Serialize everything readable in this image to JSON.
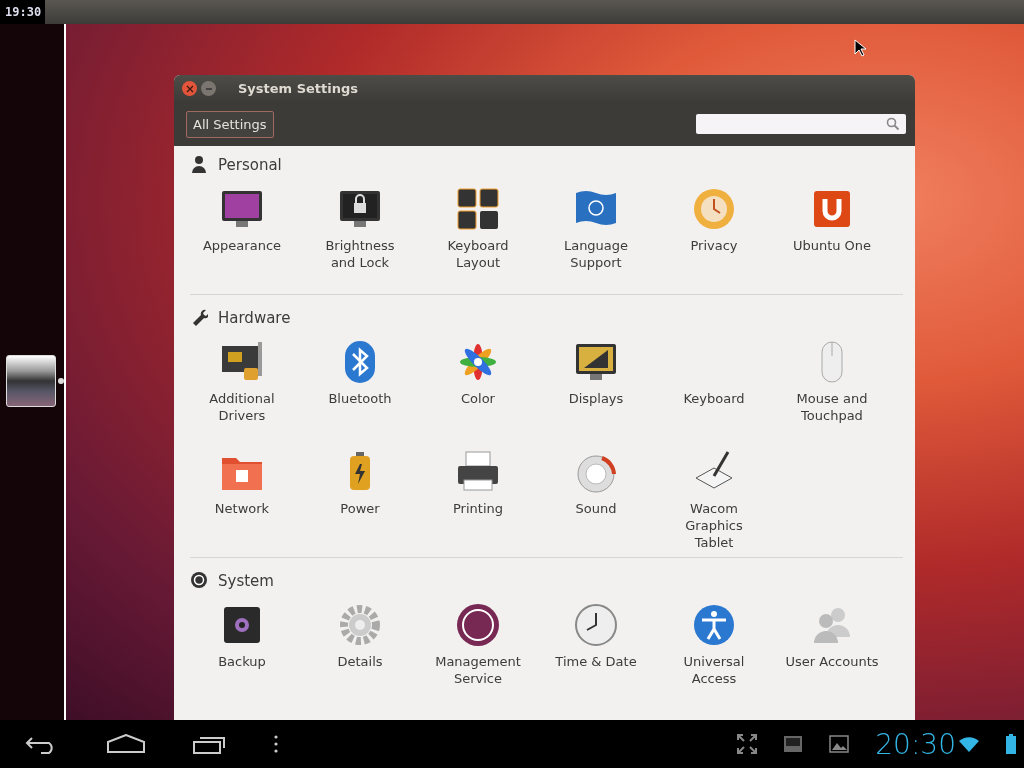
{
  "top_bar": {
    "clock": "19:30"
  },
  "window": {
    "title": "System Settings",
    "all_settings_button": "All Settings"
  },
  "sections": [
    {
      "kind": "personal",
      "title": "Personal",
      "items": [
        {
          "label": "Appearance"
        },
        {
          "label": "Brightness\nand Lock"
        },
        {
          "label": "Keyboard\nLayout"
        },
        {
          "label": "Language\nSupport"
        },
        {
          "label": "Privacy"
        },
        {
          "label": "Ubuntu One"
        }
      ]
    },
    {
      "kind": "hardware",
      "title": "Hardware",
      "items": [
        {
          "label": "Additional\nDrivers"
        },
        {
          "label": "Bluetooth"
        },
        {
          "label": "Color"
        },
        {
          "label": "Displays"
        },
        {
          "label": "Keyboard"
        },
        {
          "label": "Mouse and\nTouchpad"
        },
        {
          "label": "Network"
        },
        {
          "label": "Power"
        },
        {
          "label": "Printing"
        },
        {
          "label": "Sound"
        },
        {
          "label": "Wacom\nGraphics\nTablet"
        }
      ]
    },
    {
      "kind": "system",
      "title": "System",
      "items": [
        {
          "label": "Backup"
        },
        {
          "label": "Details"
        },
        {
          "label": "Management\nService"
        },
        {
          "label": "Time & Date"
        },
        {
          "label": "Universal\nAccess"
        },
        {
          "label": "User Accounts"
        }
      ]
    }
  ],
  "nav_bar": {
    "clock": "20:30"
  }
}
